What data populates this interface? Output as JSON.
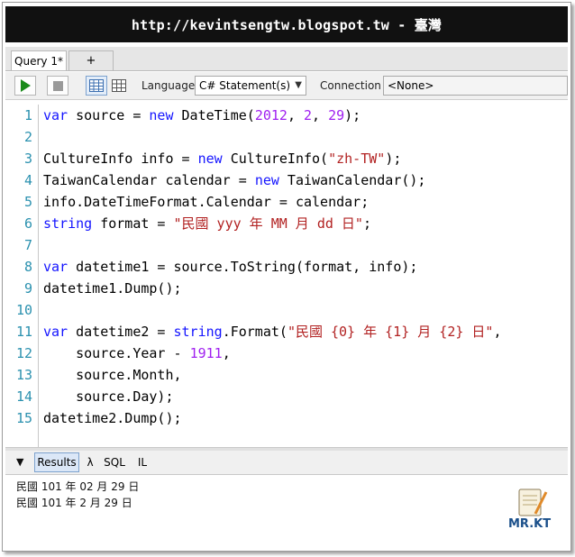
{
  "banner": {
    "text": "http://kevintsengtw.blogspot.tw - 臺灣"
  },
  "tabs": [
    {
      "label": "Query 1*"
    },
    {
      "label": "+"
    }
  ],
  "toolbar": {
    "language_label": "Language",
    "language_value": "C# Statement(s)",
    "connection_label": "Connection",
    "connection_value": "<None>"
  },
  "editor": {
    "lines": [
      {
        "num": "1",
        "tokens": [
          [
            "kw",
            "var"
          ],
          [
            "t",
            " source = "
          ],
          [
            "kw",
            "new"
          ],
          [
            "t",
            " DateTime("
          ],
          [
            "num",
            "2012"
          ],
          [
            "t",
            ", "
          ],
          [
            "num",
            "2"
          ],
          [
            "t",
            ", "
          ],
          [
            "num",
            "29"
          ],
          [
            "t",
            ");"
          ]
        ]
      },
      {
        "num": "2",
        "tokens": []
      },
      {
        "num": "3",
        "tokens": [
          [
            "t",
            "CultureInfo info = "
          ],
          [
            "kw",
            "new"
          ],
          [
            "t",
            " CultureInfo("
          ],
          [
            "str",
            "\"zh-TW\""
          ],
          [
            "t",
            ");"
          ]
        ]
      },
      {
        "num": "4",
        "tokens": [
          [
            "t",
            "TaiwanCalendar calendar = "
          ],
          [
            "kw",
            "new"
          ],
          [
            "t",
            " TaiwanCalendar();"
          ]
        ]
      },
      {
        "num": "5",
        "tokens": [
          [
            "t",
            "info.DateTimeFormat.Calendar = calendar;"
          ]
        ]
      },
      {
        "num": "6",
        "tokens": [
          [
            "kw",
            "string"
          ],
          [
            "t",
            " format = "
          ],
          [
            "str",
            "\"民國 yyy 年 MM 月 dd 日\""
          ],
          [
            "t",
            ";"
          ]
        ]
      },
      {
        "num": "7",
        "tokens": []
      },
      {
        "num": "8",
        "tokens": [
          [
            "kw",
            "var"
          ],
          [
            "t",
            " datetime1 = source.ToString(format, info);"
          ]
        ]
      },
      {
        "num": "9",
        "tokens": [
          [
            "t",
            "datetime1.Dump();"
          ]
        ]
      },
      {
        "num": "10",
        "tokens": []
      },
      {
        "num": "11",
        "tokens": [
          [
            "kw",
            "var"
          ],
          [
            "t",
            " datetime2 = "
          ],
          [
            "kw",
            "string"
          ],
          [
            "t",
            ".Format("
          ],
          [
            "str",
            "\"民國 {0} 年 {1} 月 {2} 日\""
          ],
          [
            "t",
            ","
          ]
        ]
      },
      {
        "num": "12",
        "tokens": [
          [
            "t",
            "    source.Year - "
          ],
          [
            "num",
            "1911"
          ],
          [
            "t",
            ","
          ]
        ]
      },
      {
        "num": "13",
        "tokens": [
          [
            "t",
            "    source.Month,"
          ]
        ]
      },
      {
        "num": "14",
        "tokens": [
          [
            "t",
            "    source.Day);"
          ]
        ]
      },
      {
        "num": "15",
        "tokens": [
          [
            "t",
            "datetime2.Dump();"
          ]
        ]
      }
    ]
  },
  "results_tabs": [
    {
      "label": "Results"
    },
    {
      "label": "λ"
    },
    {
      "label": "SQL"
    },
    {
      "label": "IL"
    }
  ],
  "results": [
    "民國 101 年 02 月 29 日",
    "民國 101 年 2 月 29 日"
  ],
  "logo": {
    "text": "MR.KT"
  },
  "colors": {
    "keyword": "#1515ff",
    "string": "#b22222",
    "number": "#a020f0",
    "line_number": "#2b91af",
    "banner_bg": "#111111"
  }
}
